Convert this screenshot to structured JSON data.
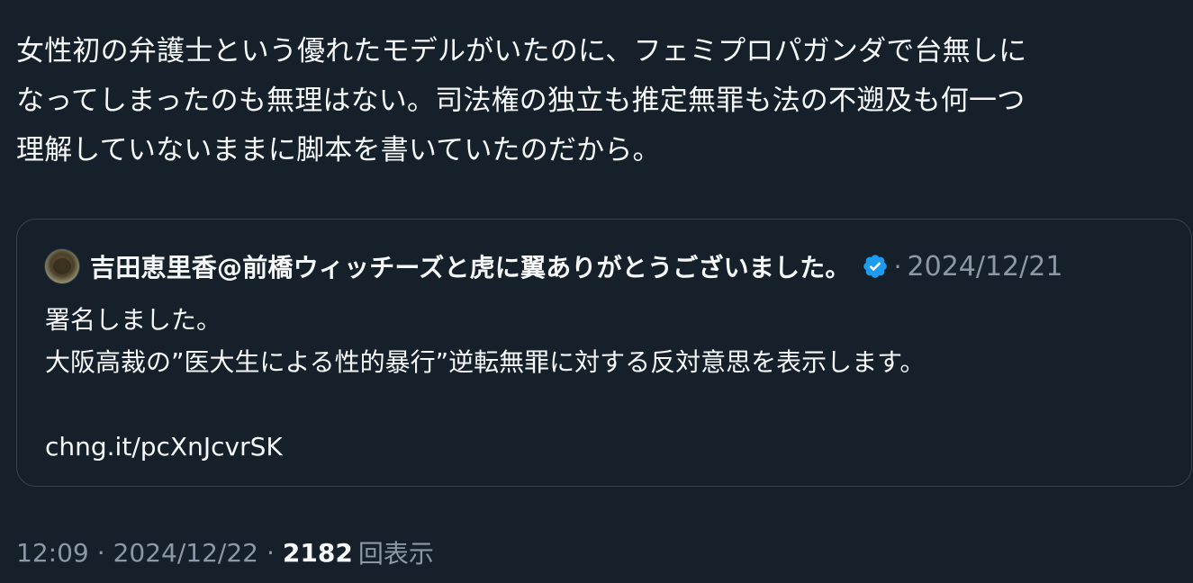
{
  "tweet": {
    "text_lines": [
      "女性初の弁護士という優れたモデルがいたのに、フェミプロパガンダで台無しに",
      "なってしまったのも無理はない。司法権の独立も推定無罪も法の不遡及も何一つ",
      "理解していないままに脚本を書いていたのだから。"
    ]
  },
  "quote": {
    "author_name": "吉田恵里香@前橋ウィッチーズと虎に翼ありがとうございました。",
    "verified_icon": "verified-badge-icon",
    "separator": "·",
    "date": "2024/12/21",
    "body_lines": [
      "署名しました。",
      "大阪高裁の”医大生による性的暴行”逆転無罪に対する反対意思を表示します。",
      "",
      "chng.it/pcXnJcvrSK"
    ]
  },
  "meta": {
    "time": "12:09",
    "separator": "·",
    "date": "2024/12/22",
    "views_count": "2182",
    "views_label": "回表示"
  },
  "colors": {
    "background": "#15202b",
    "text": "#f7f9f9",
    "secondary_text": "#8b98a5",
    "border": "#38444d",
    "verified": "#1d9bf0"
  }
}
